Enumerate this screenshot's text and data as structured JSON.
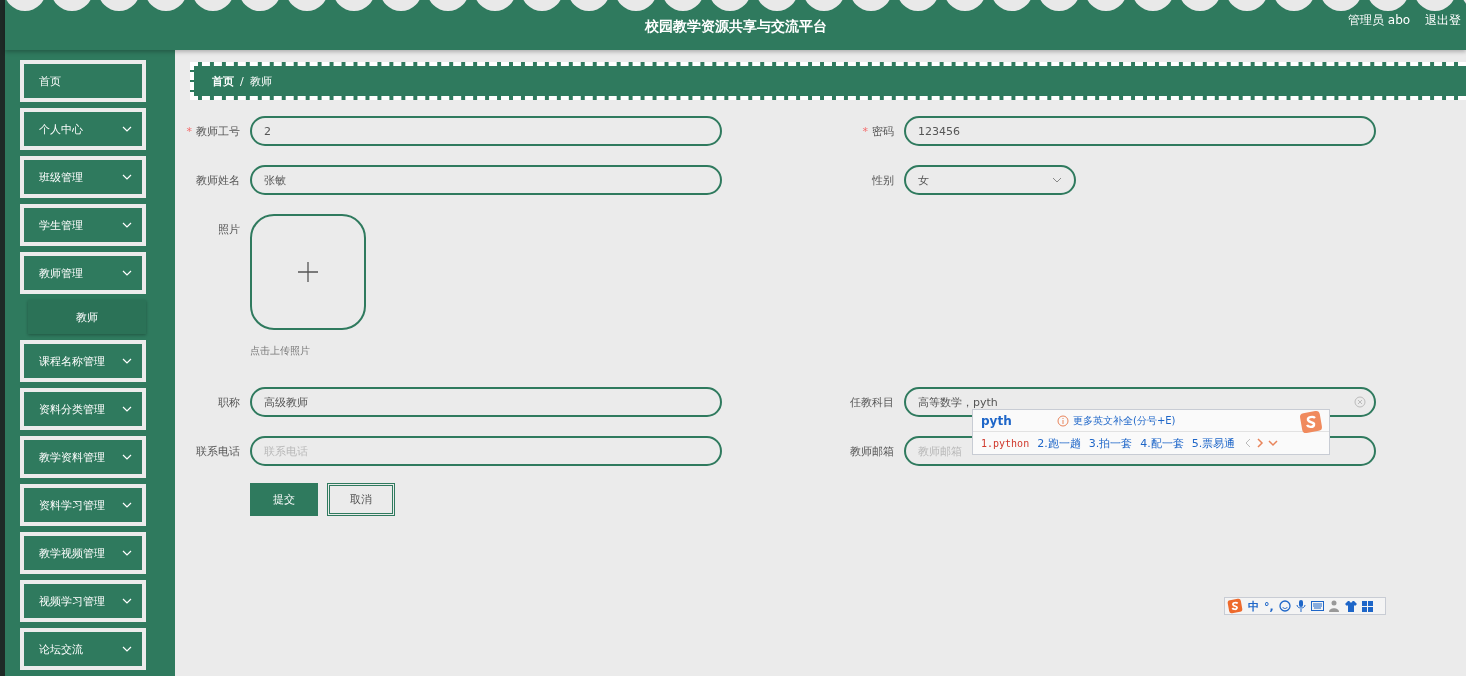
{
  "header": {
    "title": "校园教学资源共享与交流平台",
    "user": "管理员 abo",
    "logout": "退出登"
  },
  "sidebar": {
    "items": [
      {
        "label": "首页",
        "kind": "link"
      },
      {
        "label": "个人中心",
        "kind": "submenu"
      },
      {
        "label": "班级管理",
        "kind": "submenu"
      },
      {
        "label": "学生管理",
        "kind": "submenu"
      },
      {
        "label": "教师管理",
        "kind": "submenu",
        "children": [
          {
            "label": "教师"
          }
        ]
      },
      {
        "label": "课程名称管理",
        "kind": "submenu"
      },
      {
        "label": "资料分类管理",
        "kind": "submenu"
      },
      {
        "label": "教学资料管理",
        "kind": "submenu"
      },
      {
        "label": "资料学习管理",
        "kind": "submenu"
      },
      {
        "label": "教学视频管理",
        "kind": "submenu"
      },
      {
        "label": "视频学习管理",
        "kind": "submenu"
      },
      {
        "label": "论坛交流",
        "kind": "submenu"
      }
    ]
  },
  "breadcrumb": [
    "首页",
    "教师"
  ],
  "breadcrumb_separator": "/",
  "form": {
    "required_mark": "*",
    "fields": [
      {
        "label": "教师工号",
        "kind": "text",
        "required": true,
        "value": "2"
      },
      {
        "label": "密码",
        "kind": "text",
        "required": true,
        "value": "123456"
      },
      {
        "label": "教师姓名",
        "kind": "text",
        "required": false,
        "value": "张敏"
      },
      {
        "label": "性别",
        "kind": "select",
        "required": false,
        "value": "女"
      },
      {
        "label": "照片",
        "kind": "upload",
        "required": false,
        "hint": "点击上传照片"
      },
      {
        "label": "职称",
        "kind": "text",
        "required": false,
        "value": "高级教师"
      },
      {
        "label": "任教科目",
        "kind": "text",
        "required": false,
        "value": "高等数学，pyth",
        "clearable": true
      },
      {
        "label": "联系电话",
        "kind": "text",
        "required": false,
        "placeholder": "联系电话"
      },
      {
        "label": "教师邮箱",
        "kind": "text",
        "required": false,
        "placeholder": "教师邮箱"
      }
    ],
    "buttons": [
      {
        "label": "提交",
        "kind": "primary"
      },
      {
        "label": "取消",
        "kind": "plain"
      }
    ]
  },
  "ime": {
    "composition": "pyth",
    "hint": "更多英文补全(分号+E)",
    "candidates": [
      {
        "label": "1.python",
        "selected": true
      },
      {
        "label": "2.跑一趟",
        "selected": false
      },
      {
        "label": "3.拍一套",
        "selected": false
      },
      {
        "label": "4.配一套",
        "selected": false
      },
      {
        "label": "5.票易通",
        "selected": false
      }
    ]
  },
  "ime_toolbar": {
    "mode": "中",
    "punctuation": "°,"
  }
}
